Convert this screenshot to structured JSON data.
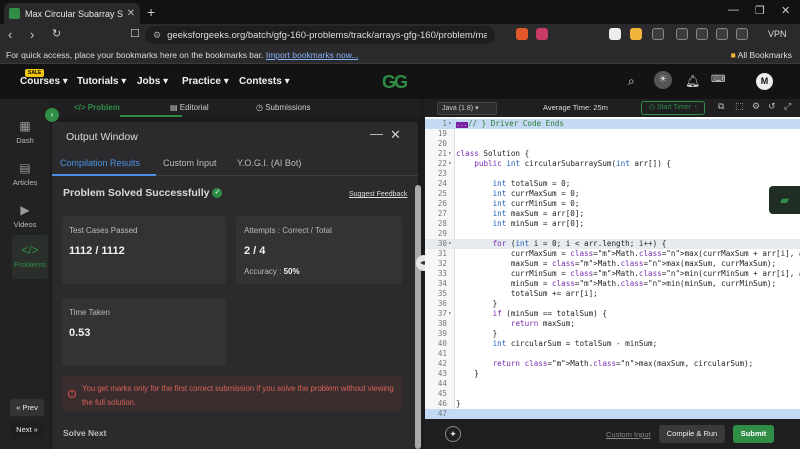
{
  "browser": {
    "tab_title": "Max Circular Subarray Sum | Pr",
    "url": "geeksforgeeks.org/batch/gfg-160-problems/track/arrays-gfg-160/problem/max-circu...",
    "bookmarks_text": "For quick access, place your bookmarks here on the bookmarks bar.",
    "import_link": "Import bookmarks now...",
    "all_bookmarks": "All Bookmarks",
    "vpn": "VPN"
  },
  "header": {
    "sale_badge": "SALE",
    "menus": [
      "Courses",
      "Tutorials",
      "Jobs",
      "Practice",
      "Contests"
    ],
    "logo": "GG",
    "avatar": "M"
  },
  "sidebar": {
    "items": [
      "Dash",
      "Articles",
      "Videos",
      "Problems"
    ],
    "prev": "« Prev",
    "next": "Next »"
  },
  "problem_tabs": [
    "Problem",
    "Editorial",
    "Submissions"
  ],
  "output": {
    "title": "Output Window",
    "tabs": [
      "Compilation Results",
      "Custom Input",
      "Y.O.G.I. (AI Bot)"
    ],
    "status": "Problem Solved Successfully",
    "feedback": "Suggest Feedback",
    "tests_label": "Test Cases Passed",
    "tests_value": "1112 / 1112",
    "attempts_label": "Attempts : Correct / Total",
    "attempts_value": "2 / 4",
    "accuracy_label": "Accuracy :",
    "accuracy_value": "50%",
    "time_label": "Time Taken",
    "time_value": "0.53",
    "warning": "You get marks only for the first correct submission if you solve the problem without viewing the full solution.",
    "solve_next": "Solve Next"
  },
  "editor": {
    "language": "Java (1.8)",
    "avg_time": "Average Time: 25m",
    "start_timer": "Start Timer",
    "custom_input": "Custom Input",
    "run": "Compile & Run",
    "submit": "Submit"
  },
  "code_lines": [
    {
      "n": "1",
      "text": " } Driver Code Ends"
    },
    {
      "n": "19",
      "text": ""
    },
    {
      "n": "20",
      "text": ""
    },
    {
      "n": "21",
      "text": "class Solution {"
    },
    {
      "n": "22",
      "text": "    public int circularSubarraySum(int arr[]) {"
    },
    {
      "n": "23",
      "text": ""
    },
    {
      "n": "24",
      "text": "        int totalSum = 0;"
    },
    {
      "n": "25",
      "text": "        int currMaxSum = 0;"
    },
    {
      "n": "26",
      "text": "        int currMinSum = 0;"
    },
    {
      "n": "27",
      "text": "        int maxSum = arr[0];"
    },
    {
      "n": "28",
      "text": "        int minSum = arr[0];"
    },
    {
      "n": "29",
      "text": ""
    },
    {
      "n": "30",
      "text": "        for (int i = 0; i < arr.length; i++) {"
    },
    {
      "n": "31",
      "text": "            currMaxSum = Math.max(currMaxSum + arr[i], arr[i]);"
    },
    {
      "n": "32",
      "text": "            maxSum = Math.max(maxSum, currMaxSum);"
    },
    {
      "n": "33",
      "text": "            currMinSum = Math.min(currMinSum + arr[i], arr[i]);"
    },
    {
      "n": "34",
      "text": "            minSum = Math.min(minSum, currMinSum);"
    },
    {
      "n": "35",
      "text": "            totalSum += arr[i];"
    },
    {
      "n": "36",
      "text": "        }"
    },
    {
      "n": "37",
      "text": "        if (minSum == totalSum) {"
    },
    {
      "n": "38",
      "text": "            return maxSum;"
    },
    {
      "n": "39",
      "text": "        }"
    },
    {
      "n": "40",
      "text": "        int circularSum = totalSum - minSum;"
    },
    {
      "n": "41",
      "text": ""
    },
    {
      "n": "42",
      "text": "        return Math.max(maxSum, circularSum);"
    },
    {
      "n": "43",
      "text": "    }"
    },
    {
      "n": "44",
      "text": ""
    },
    {
      "n": "45",
      "text": ""
    },
    {
      "n": "46",
      "text": "}"
    },
    {
      "n": "47",
      "text": ""
    }
  ],
  "colors": {
    "brand_green": "#2f8d46",
    "accent_blue": "#4a90e2",
    "warning_red": "#d9625c"
  }
}
